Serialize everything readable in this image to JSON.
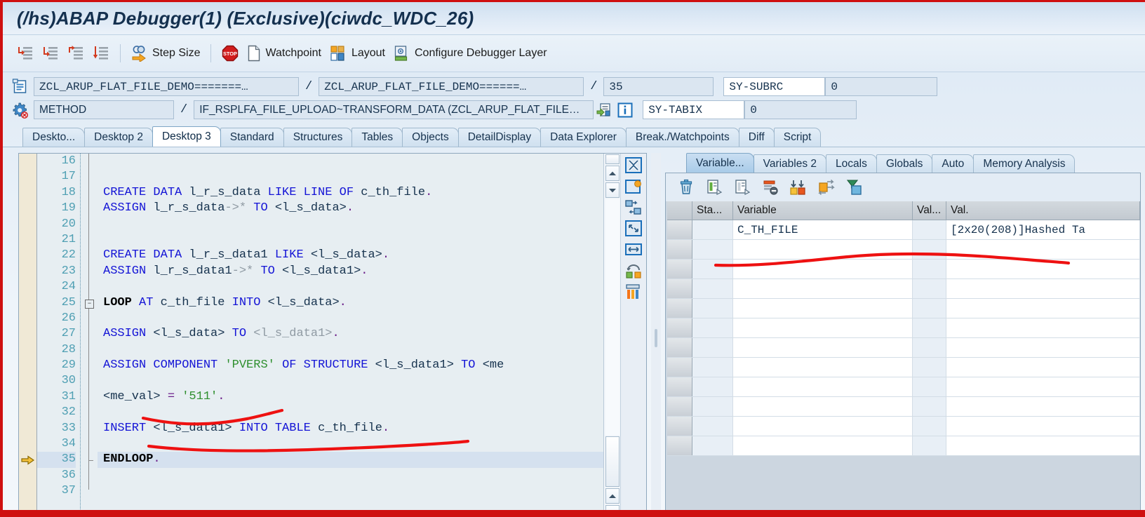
{
  "window": {
    "title": "(/hs)ABAP Debugger(1)  (Exclusive)(ciwdc_WDC_26)"
  },
  "toolbar": {
    "buttons": [
      {
        "name": "step-into-icon",
        "label": ""
      },
      {
        "name": "step-over-icon",
        "label": ""
      },
      {
        "name": "step-out-icon",
        "label": ""
      },
      {
        "name": "run-to-cursor-icon",
        "label": ""
      }
    ],
    "step_size_label": "Step Size",
    "watchpoint_label": "Watchpoint",
    "layout_label": "Layout",
    "configure_label": "Configure Debugger Layer"
  },
  "fields": {
    "program": "ZCL_ARUP_FLAT_FILE_DEMO=======…",
    "include": "ZCL_ARUP_FLAT_FILE_DEMO======…",
    "line": "35",
    "sy_subrc_label": "SY-SUBRC",
    "sy_subrc_value": "0",
    "event_type": "METHOD",
    "event_name": "IF_RSPLFA_FILE_UPLOAD~TRANSFORM_DATA (ZCL_ARUP_FLAT_FILE…",
    "sy_tabix_label": "SY-TABIX",
    "sy_tabix_value": "0",
    "slash": "/"
  },
  "desktop_tabs": [
    {
      "label": "Deskto...",
      "active": false
    },
    {
      "label": "Desktop 2",
      "active": false
    },
    {
      "label": "Desktop 3",
      "active": true
    },
    {
      "label": "Standard",
      "active": false
    },
    {
      "label": "Structures",
      "active": false
    },
    {
      "label": "Tables",
      "active": false
    },
    {
      "label": "Objects",
      "active": false
    },
    {
      "label": "DetailDisplay",
      "active": false
    },
    {
      "label": "Data Explorer",
      "active": false
    },
    {
      "label": "Break./Watchpoints",
      "active": false
    },
    {
      "label": "Diff",
      "active": false
    },
    {
      "label": "Script",
      "active": false
    }
  ],
  "code": {
    "current_line": 35,
    "lines": [
      {
        "n": "16",
        "tokens": []
      },
      {
        "n": "17",
        "tokens": []
      },
      {
        "n": "18",
        "tokens": [
          {
            "t": "    ",
            "c": ""
          },
          {
            "t": "CREATE DATA",
            "c": "kw"
          },
          {
            "t": " l_r_s_data ",
            "c": ""
          },
          {
            "t": "LIKE LINE OF",
            "c": "kw"
          },
          {
            "t": " c_th_file",
            "c": ""
          },
          {
            "t": ".",
            "c": "pun"
          }
        ]
      },
      {
        "n": "19",
        "tokens": [
          {
            "t": "    ",
            "c": ""
          },
          {
            "t": "ASSIGN",
            "c": "kw"
          },
          {
            "t": " l_r_s_data",
            "c": ""
          },
          {
            "t": "->*",
            "c": "dim"
          },
          {
            "t": " ",
            "c": ""
          },
          {
            "t": "TO",
            "c": "kw"
          },
          {
            "t": " <l_s_data>",
            "c": ""
          },
          {
            "t": ".",
            "c": "pun"
          }
        ]
      },
      {
        "n": "20",
        "tokens": []
      },
      {
        "n": "21",
        "tokens": []
      },
      {
        "n": "22",
        "tokens": [
          {
            "t": "    ",
            "c": ""
          },
          {
            "t": "CREATE DATA",
            "c": "kw"
          },
          {
            "t": " l_r_s_data1 ",
            "c": ""
          },
          {
            "t": "LIKE",
            "c": "kw"
          },
          {
            "t": " <l_s_data>",
            "c": ""
          },
          {
            "t": ".",
            "c": "pun"
          }
        ]
      },
      {
        "n": "23",
        "tokens": [
          {
            "t": "    ",
            "c": ""
          },
          {
            "t": "ASSIGN",
            "c": "kw"
          },
          {
            "t": " l_r_s_data1",
            "c": ""
          },
          {
            "t": "->*",
            "c": "dim"
          },
          {
            "t": " ",
            "c": ""
          },
          {
            "t": "TO",
            "c": "kw"
          },
          {
            "t": " <l_s_data1>",
            "c": ""
          },
          {
            "t": ".",
            "c": "pun"
          }
        ]
      },
      {
        "n": "24",
        "tokens": []
      },
      {
        "n": "25",
        "tokens": [
          {
            "t": "    ",
            "c": ""
          },
          {
            "t": "LOOP",
            "c": "kwb"
          },
          {
            "t": " ",
            "c": ""
          },
          {
            "t": "AT",
            "c": "kw"
          },
          {
            "t": " c_th_file ",
            "c": ""
          },
          {
            "t": "INTO",
            "c": "kw"
          },
          {
            "t": " <l_s_data>",
            "c": ""
          },
          {
            "t": ".",
            "c": "pun"
          }
        ]
      },
      {
        "n": "26",
        "tokens": []
      },
      {
        "n": "27",
        "tokens": [
          {
            "t": "      ",
            "c": ""
          },
          {
            "t": "ASSIGN",
            "c": "kw"
          },
          {
            "t": " <l_s_data> ",
            "c": ""
          },
          {
            "t": "TO",
            "c": "kw"
          },
          {
            "t": " <l_s_data1>",
            "c": "dim"
          },
          {
            "t": ".",
            "c": "pun"
          }
        ]
      },
      {
        "n": "28",
        "tokens": []
      },
      {
        "n": "29",
        "tokens": [
          {
            "t": "      ",
            "c": ""
          },
          {
            "t": "ASSIGN COMPONENT",
            "c": "kw"
          },
          {
            "t": " ",
            "c": ""
          },
          {
            "t": "'PVERS'",
            "c": "str"
          },
          {
            "t": " ",
            "c": ""
          },
          {
            "t": "OF STRUCTURE",
            "c": "kw"
          },
          {
            "t": " <l_s_data1> ",
            "c": ""
          },
          {
            "t": "TO",
            "c": "kw"
          },
          {
            "t": " <me",
            "c": ""
          }
        ]
      },
      {
        "n": "30",
        "tokens": []
      },
      {
        "n": "31",
        "tokens": [
          {
            "t": "      <me_val> ",
            "c": ""
          },
          {
            "t": "=",
            "c": "pun"
          },
          {
            "t": " ",
            "c": ""
          },
          {
            "t": "'511'",
            "c": "str"
          },
          {
            "t": ".",
            "c": "pun"
          }
        ]
      },
      {
        "n": "32",
        "tokens": []
      },
      {
        "n": "33",
        "tokens": [
          {
            "t": "      ",
            "c": ""
          },
          {
            "t": "INSERT",
            "c": "kw"
          },
          {
            "t": "  <l_s_data1> ",
            "c": ""
          },
          {
            "t": "INTO TABLE",
            "c": "kw"
          },
          {
            "t": " c_th_file",
            "c": ""
          },
          {
            "t": ".",
            "c": "pun"
          }
        ]
      },
      {
        "n": "34",
        "tokens": []
      },
      {
        "n": "35",
        "tokens": [
          {
            "t": "    ",
            "c": ""
          },
          {
            "t": "ENDLOOP",
            "c": "kwb"
          },
          {
            "t": ".",
            "c": "pun"
          }
        ]
      },
      {
        "n": "36",
        "tokens": []
      },
      {
        "n": "37",
        "tokens": []
      }
    ]
  },
  "variables_panel": {
    "tabs": [
      {
        "label": "Variable...",
        "active": true
      },
      {
        "label": "Variables 2",
        "active": false
      },
      {
        "label": "Locals",
        "active": false
      },
      {
        "label": "Globals",
        "active": false
      },
      {
        "label": "Auto",
        "active": false
      },
      {
        "label": "Memory Analysis",
        "active": false
      }
    ],
    "toolbar_icons": [
      "delete-icon",
      "copy-row-icon",
      "copy-detail-icon",
      "remove-row-icon",
      "sort-icon",
      "replace-icon",
      "filter-icon"
    ],
    "columns": [
      "",
      "Sta...",
      "Variable",
      "Val...",
      "Val."
    ],
    "rows": [
      {
        "sta": "",
        "variable": "C_TH_FILE",
        "vs": "",
        "value": "[2x20(208)]Hashed Ta"
      },
      {
        "sta": "",
        "variable": "",
        "vs": "",
        "value": ""
      },
      {
        "sta": "",
        "variable": "",
        "vs": "",
        "value": ""
      },
      {
        "sta": "",
        "variable": "",
        "vs": "",
        "value": ""
      },
      {
        "sta": "",
        "variable": "",
        "vs": "",
        "value": ""
      },
      {
        "sta": "",
        "variable": "",
        "vs": "",
        "value": ""
      },
      {
        "sta": "",
        "variable": "",
        "vs": "",
        "value": ""
      },
      {
        "sta": "",
        "variable": "",
        "vs": "",
        "value": ""
      },
      {
        "sta": "",
        "variable": "",
        "vs": "",
        "value": ""
      },
      {
        "sta": "",
        "variable": "",
        "vs": "",
        "value": ""
      },
      {
        "sta": "",
        "variable": "",
        "vs": "",
        "value": ""
      },
      {
        "sta": "",
        "variable": "",
        "vs": "",
        "value": ""
      }
    ]
  },
  "colors": {
    "annotation_red": "#ee1111",
    "accent_blue": "#1414d6",
    "string_green": "#2f8f2f",
    "line_number": "#4f9fb3",
    "current_line_bg": "#d5e1ef",
    "breakpoint_gutter": "#f0e9d6"
  }
}
